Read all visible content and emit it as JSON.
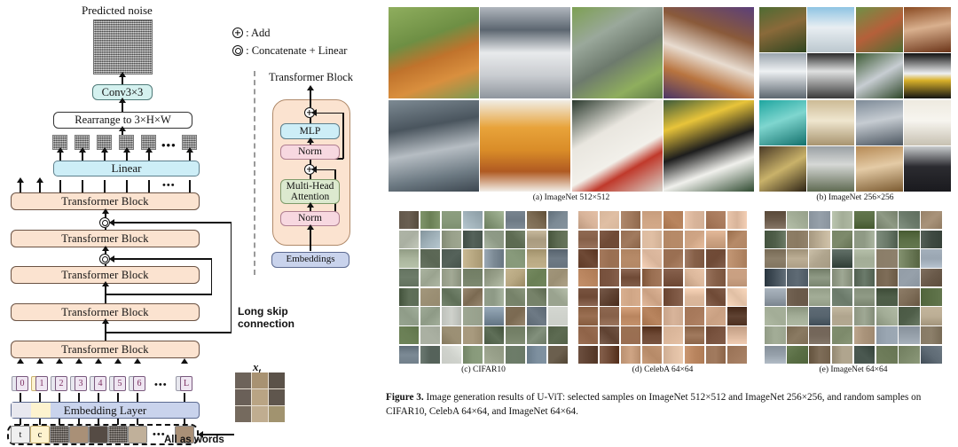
{
  "diagram": {
    "title_predicted_noise": "Predicted noise",
    "conv_label": "Conv3×3",
    "rearrange_label": "Rearrange to 3×H×W",
    "linear_label": "Linear",
    "transformer_block_label": "Transformer Block",
    "embedding_layer_label": "Embedding Layer",
    "long_skip_label_line1": "Long skip",
    "long_skip_label_line2": "connection",
    "all_as_words_label": "All as words",
    "xt_label": "x",
    "xt_sub": "t",
    "ellipsis": "•••",
    "legend": [
      {
        "symbol": "add-circle-icon",
        "text": ": Add"
      },
      {
        "symbol": "concat-circle-icon",
        "text": ": Concatenate + Linear"
      }
    ],
    "token_indices": [
      "0",
      "1",
      "2",
      "3",
      "4",
      "5",
      "6",
      "L"
    ],
    "word_cells": [
      "t",
      "c"
    ],
    "transformer_block_detail": {
      "title": "Transformer Block",
      "rows": [
        "MLP",
        "Norm",
        "Multi-Head\nAttention",
        "Norm"
      ],
      "mlp_label": "MLP",
      "norm_top_label": "Norm",
      "attention_label_line1": "Multi-Head",
      "attention_label_line2": "Attention",
      "norm_bottom_label": "Norm",
      "embeddings_label": "Embeddings"
    },
    "stack_count": 5,
    "colors": {
      "transformer_block": "#fbe3d0",
      "linear": "#cdeef7",
      "conv": "#d4f1ef",
      "norm": "#f7d8e0",
      "attention": "#dce9cf",
      "embeddings": "#c9d3ec",
      "noise": "#9a9a9a"
    }
  },
  "figure": {
    "panels": [
      {
        "id": "a",
        "caption": "(a) ImageNet 512×512",
        "rows": 2,
        "cols": 4
      },
      {
        "id": "b",
        "caption": "(b) ImageNet 256×256",
        "rows": 4,
        "cols": 4
      },
      {
        "id": "c",
        "caption": "(c) CIFAR10",
        "rows": 8,
        "cols": 8
      },
      {
        "id": "d",
        "caption": "(d) CelebA 64×64",
        "rows": 8,
        "cols": 8
      },
      {
        "id": "e",
        "caption": "(e) ImageNet 64×64",
        "rows": 8,
        "cols": 8
      }
    ],
    "caption_number": "Figure 3.",
    "caption_text": " Image generation results of U-ViT: selected samples on ImageNet 512×512 and ImageNet 256×256, and random samples on CIFAR10, CelebA 64×64, and ImageNet 64×64."
  },
  "palettes": {
    "a": [
      "#a8612a",
      "#c8cbd0",
      "#6f8f4a",
      "#7b4f8e",
      "#6a7f8c",
      "#d99a3a",
      "#cfcfc6",
      "#2f4f3a"
    ],
    "b": [
      "#5c7a3c",
      "#9ec5e0",
      "#7d9a52",
      "#b4724a",
      "#8d9aa6",
      "#cfd3d6",
      "#6d8a5a",
      "#1b2b33",
      "#2fa8a0",
      "#c9bfa6",
      "#7b8fa3",
      "#ddd8c8",
      "#4a3b2e",
      "#8a8f94",
      "#c9a37a",
      "#2b2b2f"
    ],
    "c": [
      "#7d8f9e",
      "#98a08a",
      "#7b6a52",
      "#9fb0b8",
      "#b2a15c",
      "#cfd2cc",
      "#6a7f55",
      "#a89a7e",
      "#7a8a6e",
      "#55625a",
      "#8c9a7d",
      "#7f6e58",
      "#95a28d",
      "#6e7a85",
      "#b8a882",
      "#5d6b52",
      "#8f9c88",
      "#aab0a2",
      "#6b5f4e",
      "#889a7b",
      "#9aa38f",
      "#7c8a95",
      "#5f6f58",
      "#a3aa96",
      "#6d7c69",
      "#9b8f74",
      "#82907c",
      "#6a5f52",
      "#aab59d",
      "#768269",
      "#8e9a86",
      "#5a6654"
    ],
    "d": [
      "#b9855f",
      "#8b5f45",
      "#d8b49a",
      "#a87a5c",
      "#6f4a36",
      "#e0bfa4",
      "#8f6348",
      "#c9a082",
      "#7a5440",
      "#cfa585",
      "#9a6f52",
      "#b68a68",
      "#5f4232",
      "#dcb89c",
      "#866049",
      "#a17a5e"
    ],
    "e": [
      "#6c7a58",
      "#9aa6b2",
      "#5a6e45",
      "#8a7a62",
      "#b0a58e",
      "#44505a",
      "#7d8a6b",
      "#a9937a",
      "#5f6b75",
      "#8f9a85",
      "#6a5a4a",
      "#bcae95",
      "#4f5e49",
      "#96a0aa",
      "#7e6d58",
      "#3f4a42",
      "#a3ad97",
      "#6b7a6a",
      "#8c7f6a",
      "#57646e",
      "#9fa894",
      "#74675a",
      "#b2a892",
      "#4a5850"
    ]
  }
}
